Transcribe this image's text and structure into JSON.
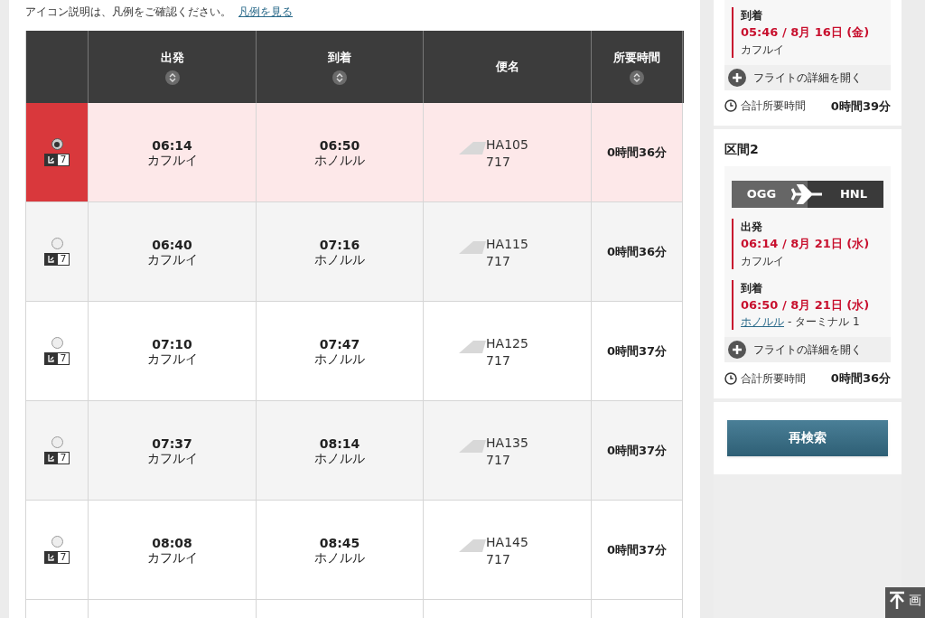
{
  "notice": {
    "text": "アイコン説明は、凡例をご確認ください。",
    "link": "凡例を見る"
  },
  "table": {
    "columns": [
      {
        "sortable": false
      },
      {
        "label": "出発",
        "sortable": true
      },
      {
        "label": "到着",
        "sortable": true
      },
      {
        "label": "便名",
        "sortable": false
      },
      {
        "label": "所要時間",
        "sortable": true
      }
    ],
    "rows": [
      {
        "selected": true,
        "seat_count": "7",
        "dep_time": "06:14",
        "dep_city": "カフルイ",
        "arr_time": "06:50",
        "arr_city": "ホノルル",
        "flight": "HA105",
        "aircraft": "717",
        "duration": "0時間36分"
      },
      {
        "selected": false,
        "seat_count": "7",
        "dep_time": "06:40",
        "dep_city": "カフルイ",
        "arr_time": "07:16",
        "arr_city": "ホノルル",
        "flight": "HA115",
        "aircraft": "717",
        "duration": "0時間36分"
      },
      {
        "selected": false,
        "seat_count": "7",
        "dep_time": "07:10",
        "dep_city": "カフルイ",
        "arr_time": "07:47",
        "arr_city": "ホノルル",
        "flight": "HA125",
        "aircraft": "717",
        "duration": "0時間37分"
      },
      {
        "selected": false,
        "seat_count": "7",
        "dep_time": "07:37",
        "dep_city": "カフルイ",
        "arr_time": "08:14",
        "arr_city": "ホノルル",
        "flight": "HA135",
        "aircraft": "717",
        "duration": "0時間37分"
      },
      {
        "selected": false,
        "seat_count": "7",
        "dep_time": "08:08",
        "dep_city": "カフルイ",
        "arr_time": "08:45",
        "arr_city": "ホノルル",
        "flight": "HA145",
        "aircraft": "717",
        "duration": "0時間37分"
      }
    ]
  },
  "summary": {
    "segments": [
      {
        "stops": [
          {
            "label": "到着",
            "datetime": "05:46 / 8月 16日 (金)",
            "place": "カフルイ",
            "place_link": false
          }
        ],
        "details_button": "フライトの詳細を開く",
        "total_label": "合計所要時間",
        "total": "0時間39分"
      },
      {
        "title": "区間2",
        "route": {
          "from": "OGG",
          "to": "HNL"
        },
        "stops": [
          {
            "label": "出発",
            "datetime": "06:14 / 8月 21日 (水)",
            "place": "カフルイ",
            "place_link": false
          },
          {
            "label": "到着",
            "datetime": "06:50 / 8月 21日 (水)",
            "place": "ホノルル",
            "place_link": true,
            "terminal": "- ターミナル 1"
          }
        ],
        "details_button": "フライトの詳細を開く",
        "total_label": "合計所要時間",
        "total": "0時間36分"
      }
    ],
    "search_again": "再検索"
  },
  "page_top": {
    "label": "画"
  }
}
